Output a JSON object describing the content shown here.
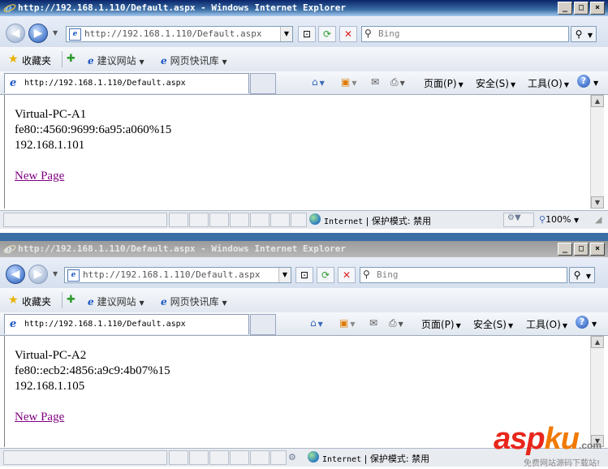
{
  "windows": [
    {
      "title": "http://192.168.1.110/Default.aspx - Windows Internet Explorer",
      "address": "http://192.168.1.110/Default.aspx",
      "search_placeholder": "Bing",
      "favorites": {
        "label": "收藏夹",
        "items": [
          "建议网站",
          "网页快讯库"
        ]
      },
      "tab_title": "http://192.168.1.110/Default.aspx",
      "commands": [
        "页面(P)",
        "安全(S)",
        "工具(O)"
      ],
      "content": {
        "lines": [
          "Virtual-PC-A1",
          "fe80::4560:9699:6a95:a060%15",
          "192.168.1.101"
        ],
        "link": "New Page"
      },
      "status": {
        "zone": "Internet",
        "protected_mode": "保护模式: 禁用",
        "zoom": "100%"
      }
    },
    {
      "title": "http://192.168.1.110/Default.aspx - Windows Internet Explorer",
      "address": "http://192.168.1.110/Default.aspx",
      "search_placeholder": "Bing",
      "favorites": {
        "label": "收藏夹",
        "items": [
          "建议网站",
          "网页快讯库"
        ]
      },
      "tab_title": "http://192.168.1.110/Default.aspx",
      "commands": [
        "页面(P)",
        "安全(S)",
        "工具(O)"
      ],
      "content": {
        "lines": [
          "Virtual-PC-A2",
          "fe80::ecb2:4856:a9c9:4b07%15",
          "192.168.1.105"
        ],
        "link": "New Page"
      },
      "status": {
        "zone": "Internet",
        "protected_mode": "保护模式: 禁用"
      }
    }
  ],
  "watermark": {
    "brand_a": "asp",
    "brand_b": "ku",
    "suffix": ".com",
    "sub": "免费网站源码下载站!"
  },
  "colors": {
    "visited_link": "#800080",
    "title_active": "#0a246a",
    "title_inactive": "#9a9a9a"
  }
}
